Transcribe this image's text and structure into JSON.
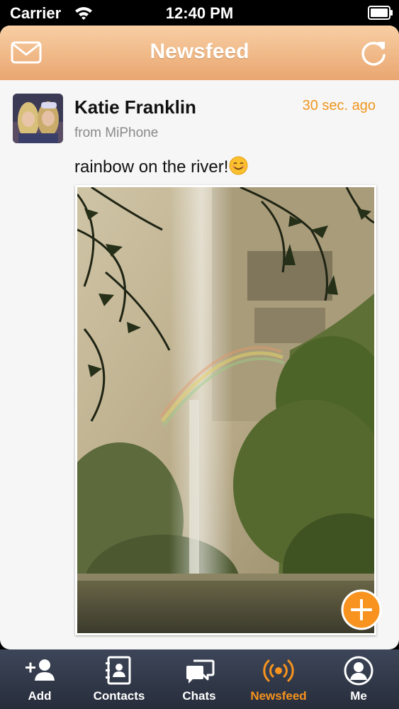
{
  "status_bar": {
    "carrier": "Carrier",
    "time": "12:40 PM"
  },
  "navbar": {
    "title": "Newsfeed",
    "left_icon": "mail-icon",
    "right_icon": "refresh-icon"
  },
  "post": {
    "author": "Katie Franklin",
    "time": "30 sec. ago",
    "source": "from MiPhone",
    "text": "rainbow on the river!",
    "emoji": "smiley-emoji",
    "photo": "waterfall-rainbow-photo"
  },
  "fab": {
    "icon": "plus-icon"
  },
  "tabs": [
    {
      "label": "Add",
      "icon": "add-contact-icon"
    },
    {
      "label": "Contacts",
      "icon": "contacts-book-icon"
    },
    {
      "label": "Chats",
      "icon": "chat-bubbles-icon"
    },
    {
      "label": "Newsfeed",
      "icon": "broadcast-icon",
      "active": true
    },
    {
      "label": "Me",
      "icon": "person-icon"
    }
  ],
  "colors": {
    "accent": "#f7931e",
    "nav_gradient_top": "#f8cfa4",
    "nav_gradient_bottom": "#e9a670",
    "tab_bar": "#2f3645"
  }
}
